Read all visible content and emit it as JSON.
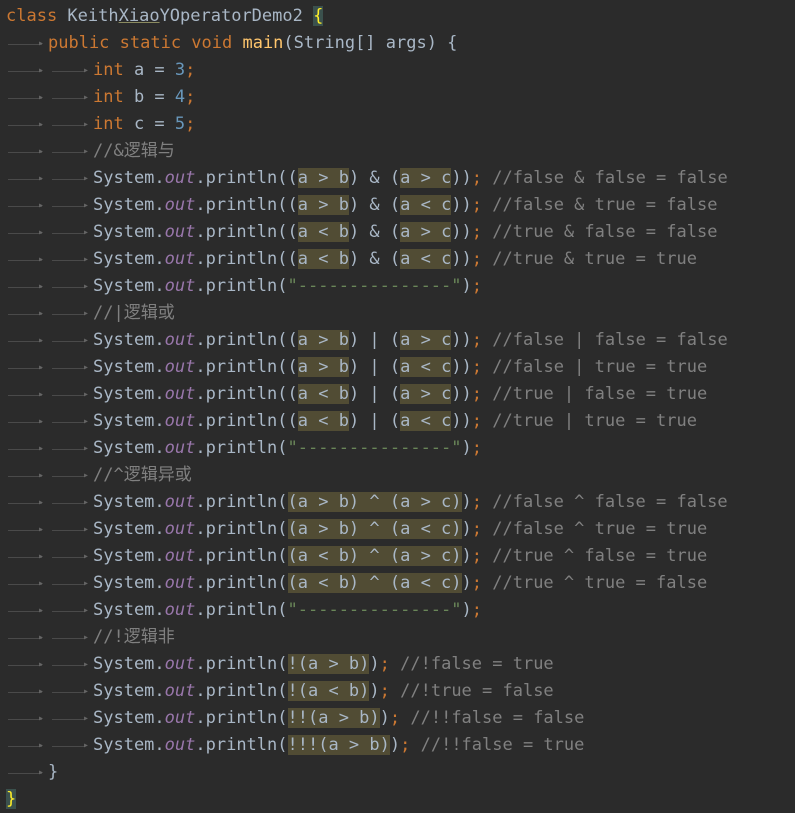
{
  "editor": {
    "class_line": {
      "kw": "class",
      "name_pre": "Keith",
      "name_ul": "Xiao",
      "name_post": "YOperatorDemo2",
      "brace": "{"
    },
    "main_line": {
      "mods": "public static void",
      "name": "main",
      "params": "(String[] args) {"
    },
    "decls": [
      {
        "type": "int",
        "text": " a = ",
        "value": "3",
        "semi": ";"
      },
      {
        "type": "int",
        "text": " b = ",
        "value": "4",
        "semi": ";"
      },
      {
        "type": "int",
        "text": " c = ",
        "value": "5",
        "semi": ";"
      }
    ],
    "sections": [
      {
        "comment": "//&逻辑与",
        "rows": [
          {
            "pre": "((",
            "a": "a > b",
            "op": ") & (",
            "b": "a > c",
            "post": "))",
            "comment": "//false & false = false"
          },
          {
            "pre": "((",
            "a": "a > b",
            "op": ") & (",
            "b": "a < c",
            "post": "))",
            "comment": "//false & true = false"
          },
          {
            "pre": "((",
            "a": "a < b",
            "op": ") & (",
            "b": "a > c",
            "post": "))",
            "comment": "//true & false = false"
          },
          {
            "pre": "((",
            "a": "a < b",
            "op": ") & (",
            "b": "a < c",
            "post": "))",
            "comment": "//true & true = true"
          }
        ]
      },
      {
        "comment": "//|逻辑或",
        "rows": [
          {
            "pre": "((",
            "a": "a > b",
            "op": ") | (",
            "b": "a > c",
            "post": "))",
            "comment": "//false | false = false"
          },
          {
            "pre": "((",
            "a": "a > b",
            "op": ") | (",
            "b": "a < c",
            "post": "))",
            "comment": "//false | true = true"
          },
          {
            "pre": "((",
            "a": "a < b",
            "op": ") | (",
            "b": "a > c",
            "post": "))",
            "comment": "//true | false = true"
          },
          {
            "pre": "((",
            "a": "a < b",
            "op": ") | (",
            "b": "a < c",
            "post": "))",
            "comment": "//true | true = true"
          }
        ]
      },
      {
        "comment": "//^逻辑异或",
        "rows": [
          {
            "pre": "(",
            "a": "(a > b) ^ (a > c)",
            "op": "",
            "b": "",
            "post": ")",
            "comment": "//false ^ false = false"
          },
          {
            "pre": "(",
            "a": "(a > b) ^ (a < c)",
            "op": "",
            "b": "",
            "post": ")",
            "comment": "//false ^ true = true"
          },
          {
            "pre": "(",
            "a": "(a < b) ^ (a > c)",
            "op": "",
            "b": "",
            "post": ")",
            "comment": "//true ^ false = true"
          },
          {
            "pre": "(",
            "a": "(a < b) ^ (a < c)",
            "op": "",
            "b": "",
            "post": ")",
            "comment": "//true ^ true = false"
          }
        ]
      },
      {
        "comment": "//!逻辑非",
        "rows": [
          {
            "pre": "(",
            "a": "!(a > b)",
            "op": "",
            "b": "",
            "post": ")",
            "comment": "//!false = true"
          },
          {
            "pre": "(",
            "a": "!(a < b)",
            "op": "",
            "b": "",
            "post": ")",
            "comment": "//!true = false"
          },
          {
            "pre": "(",
            "a": "!!(a > b)",
            "op": "",
            "b": "",
            "post": ")",
            "comment": "//!!false = false"
          },
          {
            "pre": "(",
            "a": "!!!(a > b)",
            "op": "",
            "b": "",
            "post": ")",
            "comment": "//!!false = true"
          }
        ]
      }
    ],
    "separator_string": "\"---------------\"",
    "sys": "System.",
    "out": "out",
    "println": ".println",
    "close_method": "}",
    "close_class": "}"
  },
  "colors": {
    "background": "#2b2b2b",
    "keyword": "#cc7832",
    "text": "#a9b7c6",
    "method": "#ffc66d",
    "number": "#6897bb",
    "field": "#9876aa",
    "string": "#6a8759",
    "comment": "#808080",
    "highlight": "#514c34"
  }
}
